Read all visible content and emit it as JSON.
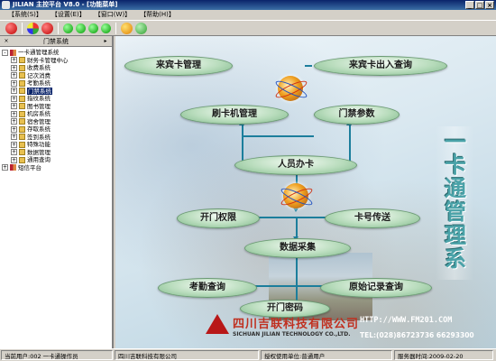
{
  "window": {
    "title": "JILIAN 主控平台 V8.0 - [功能菜单]",
    "controls": [
      "_",
      "□",
      "×"
    ]
  },
  "menu": [
    "【系统(S)】",
    "【设置(E)】",
    "【窗口(W)】",
    "【帮助(H)】"
  ],
  "toolbar": {
    "icons": [
      "exit-icon",
      "module-icon",
      "back-icon",
      "play-icon",
      "play-icon",
      "play-icon",
      "play-icon",
      "globe-icon",
      "check-icon"
    ]
  },
  "left_panel": {
    "title": "门禁系统",
    "close_glyph": "×",
    "pin_glyph": "▸",
    "tree": [
      {
        "label": "一卡通管理系统",
        "level": 0,
        "expander": "-"
      },
      {
        "label": "财务卡管理中心",
        "level": 1,
        "expander": "+"
      },
      {
        "label": "收费系统",
        "level": 1,
        "expander": "+"
      },
      {
        "label": "记次消费",
        "level": 1,
        "expander": "+"
      },
      {
        "label": "考勤系统",
        "level": 1,
        "expander": "+"
      },
      {
        "label": "门禁系统",
        "level": 1,
        "expander": "+",
        "selected": true
      },
      {
        "label": "指纹系统",
        "level": 1,
        "expander": "+"
      },
      {
        "label": "图书管理",
        "level": 1,
        "expander": "+"
      },
      {
        "label": "机房系统",
        "level": 1,
        "expander": "+"
      },
      {
        "label": "宿舍管理",
        "level": 1,
        "expander": "+"
      },
      {
        "label": "存取系统",
        "level": 1,
        "expander": "+"
      },
      {
        "label": "签到系统",
        "level": 1,
        "expander": "+"
      },
      {
        "label": "特殊功能",
        "level": 1,
        "expander": "+"
      },
      {
        "label": "数据管理",
        "level": 1,
        "expander": "+"
      },
      {
        "label": "通用查询",
        "level": 1,
        "expander": "+"
      },
      {
        "label": "短信平台",
        "level": 0,
        "expander": "+"
      }
    ]
  },
  "main": {
    "nodes": {
      "guest_card": "来宾卡管理",
      "guest_query": "来宾卡出入查询",
      "reader_mgmt": "刷卡机管理",
      "door_params": "门禁参数",
      "issue_card": "人员办卡",
      "door_perm": "开门权限",
      "card_send": "卡号传送",
      "data_collect": "数据采集",
      "att_query": "考勤查询",
      "raw_query": "原始记录查询",
      "door_pwd": "开门密码"
    },
    "vertical_title": [
      "一",
      "卡",
      "通",
      "管",
      "理",
      "系",
      "统"
    ],
    "company": {
      "name": "四川吉联科技有限公司",
      "name_en": "SICHUAN JILIAN TECHNOLOGY CO.,LTD.",
      "url": "HTTP://WWW.FM201.COM",
      "tel": "TEL:(028)86723736 66293300"
    }
  },
  "status": {
    "user": "当前用户:002 一卡通操作员",
    "company": "四川吉联科技有限公司",
    "license": "授权使用单位:普通用户",
    "server": "服务器时间:2009-02-20"
  },
  "colors": {
    "pill_fill": "#b8dcbc",
    "connector": "#1c7e9c",
    "brand_red": "#c03020",
    "title_teal": "#4aa2a8"
  }
}
